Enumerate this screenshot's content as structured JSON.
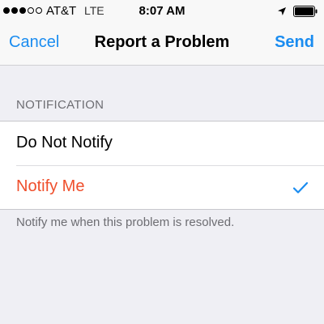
{
  "status_bar": {
    "carrier": "AT&T",
    "network": "LTE",
    "time": "8:07 AM",
    "signal_bars_filled": 3,
    "signal_bars_total": 5,
    "icons": [
      "signal-dots-icon",
      "location-arrow-icon",
      "battery-icon"
    ]
  },
  "nav": {
    "cancel_label": "Cancel",
    "title": "Report a Problem",
    "send_label": "Send"
  },
  "notification": {
    "header": "NOTIFICATION",
    "options": [
      {
        "label": "Do Not Notify",
        "selected": false
      },
      {
        "label": "Notify Me",
        "selected": true
      }
    ],
    "footer": "Notify me when this problem is resolved."
  },
  "colors": {
    "accent_blue": "#1a8cf0",
    "selected_red": "#ef4f2c",
    "background": "#efeff4"
  }
}
